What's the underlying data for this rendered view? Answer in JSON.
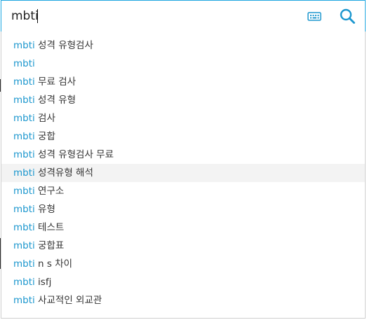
{
  "colors": {
    "accent": "#1ea7e1",
    "keyword": "#1a96ce",
    "hover": "#f3f3f3"
  },
  "search": {
    "value": "mbti",
    "keyboard_icon": "keyboard-icon",
    "search_icon": "search-icon"
  },
  "suggestions": [
    {
      "keyword": "mbti",
      "rest": " 성격 유형검사"
    },
    {
      "keyword": "mbti",
      "rest": ""
    },
    {
      "keyword": "mbti",
      "rest": " 무료 검사"
    },
    {
      "keyword": "mbti",
      "rest": " 성격 유형"
    },
    {
      "keyword": "mbti",
      "rest": " 검사"
    },
    {
      "keyword": "mbti",
      "rest": " 궁합"
    },
    {
      "keyword": "mbti",
      "rest": " 성격 유형검사 무료"
    },
    {
      "keyword": "mbti",
      "rest": " 성격유형 해석"
    },
    {
      "keyword": "mbti",
      "rest": " 연구소"
    },
    {
      "keyword": "mbti",
      "rest": " 유형"
    },
    {
      "keyword": "mbti",
      "rest": " 테스트"
    },
    {
      "keyword": "mbti",
      "rest": " 궁합표"
    },
    {
      "keyword": "mbti",
      "rest": " n s 차이"
    },
    {
      "keyword": "mbti",
      "rest": " isfj"
    },
    {
      "keyword": "mbti",
      "rest": " 사교적인 외교관"
    }
  ],
  "highlighted_index": 7
}
